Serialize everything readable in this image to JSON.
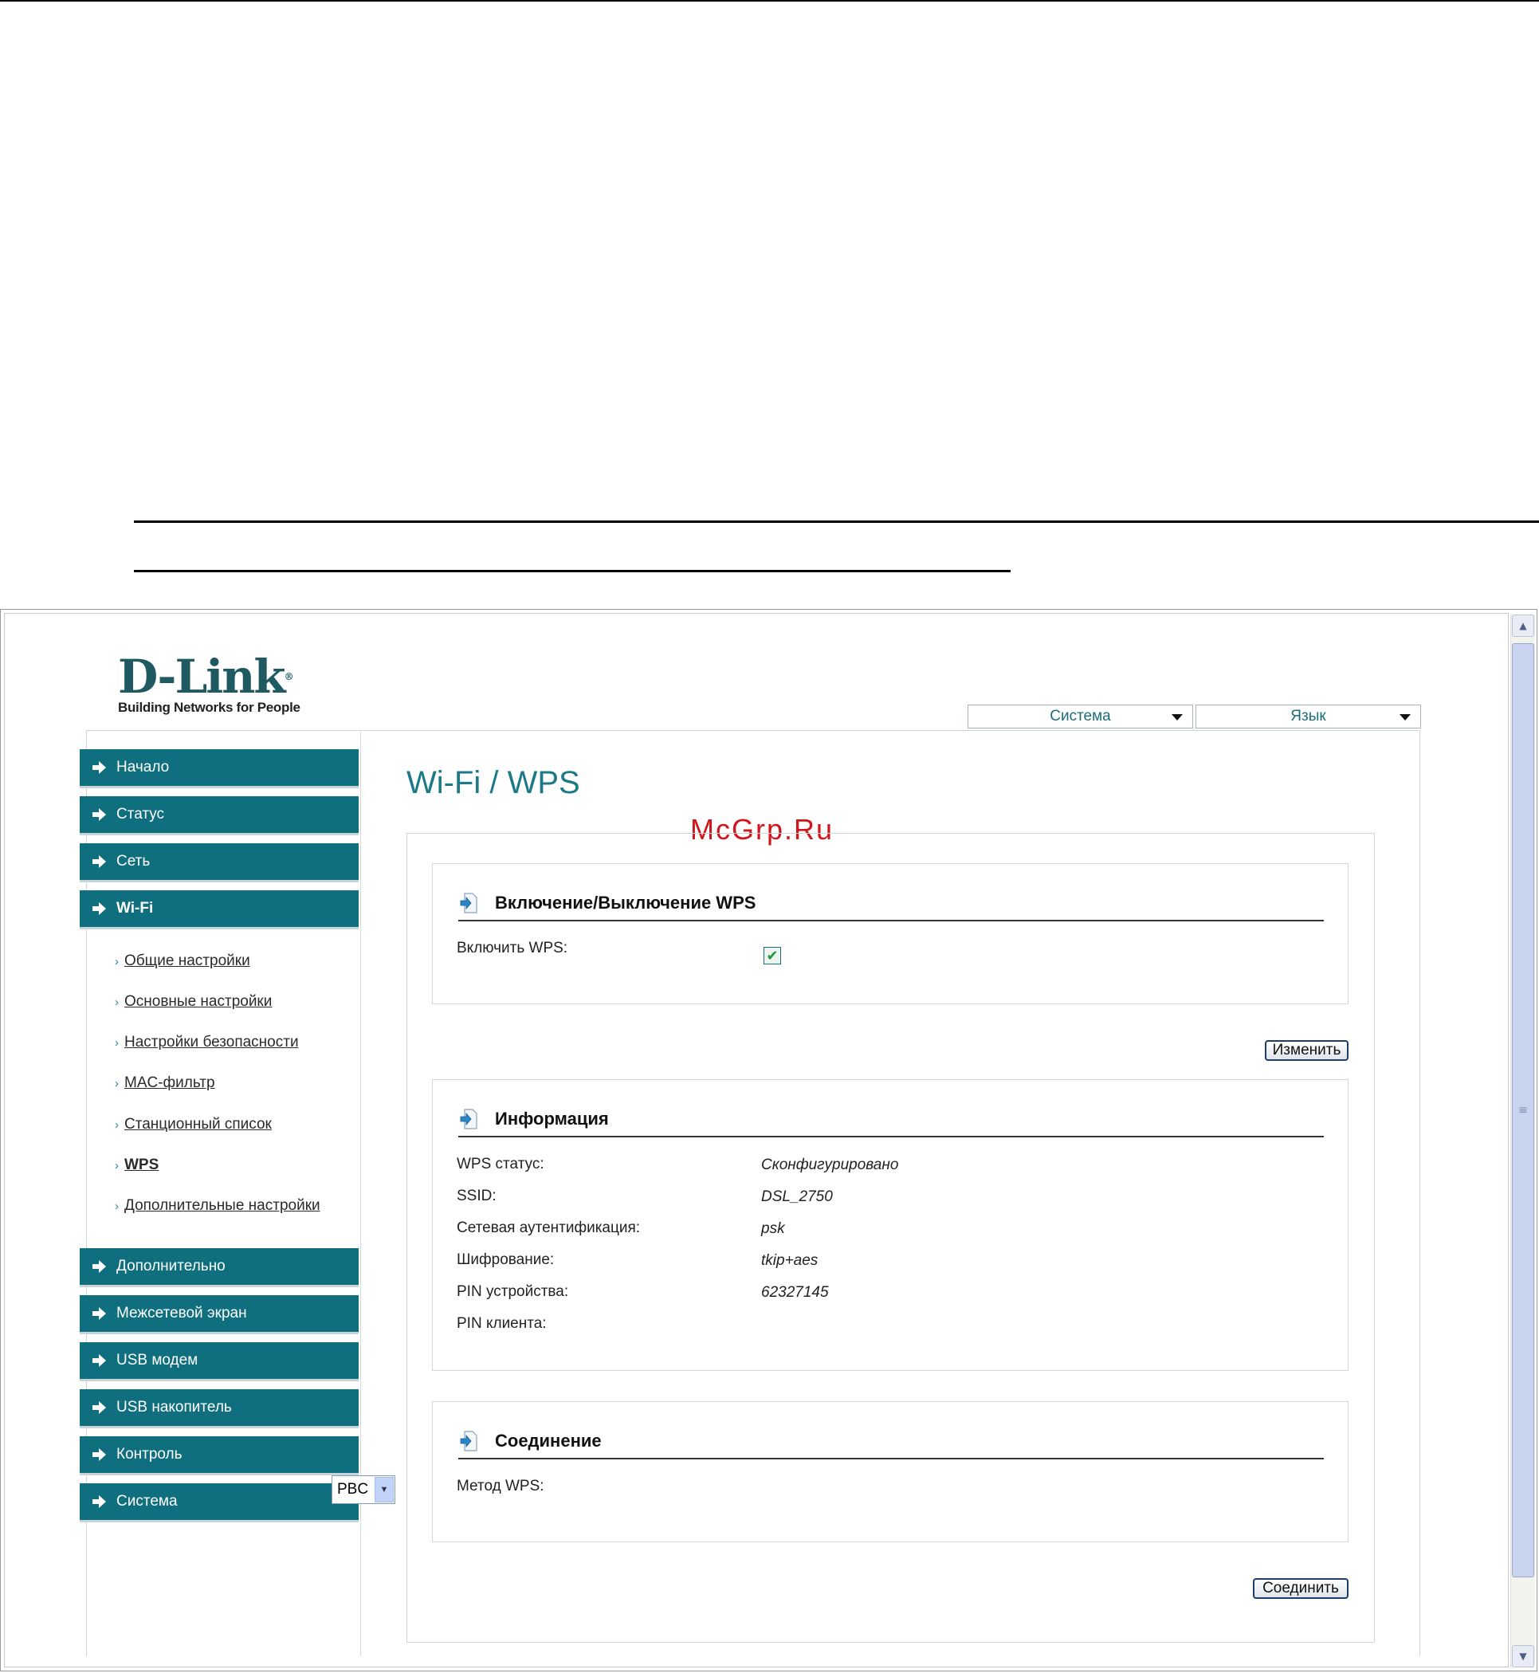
{
  "brand": {
    "logo_text": "D-Link",
    "tagline": "Building Networks for People"
  },
  "top_menu": {
    "system_label": "Система",
    "language_label": "Язык"
  },
  "sidebar": {
    "items": [
      {
        "label": "Начало"
      },
      {
        "label": "Статус"
      },
      {
        "label": "Сеть"
      },
      {
        "label": "Wi-Fi"
      },
      {
        "label": "Дополнительно"
      },
      {
        "label": "Межсетевой экран"
      },
      {
        "label": "USB модем"
      },
      {
        "label": "USB накопитель"
      },
      {
        "label": "Контроль"
      },
      {
        "label": "Система"
      }
    ],
    "wifi_subitems": [
      {
        "label": "Общие настройки"
      },
      {
        "label": "Основные настройки"
      },
      {
        "label": "Настройки безопасности"
      },
      {
        "label": "MAC-фильтр"
      },
      {
        "label": "Станционный список"
      },
      {
        "label": "WPS"
      },
      {
        "label": "Дополнительные настройки"
      }
    ],
    "active_subitem": "WPS"
  },
  "page": {
    "title": "Wi-Fi / WPS",
    "watermark": "McGrp.Ru"
  },
  "sections": {
    "wps_toggle": {
      "title": "Включение/Выключение WPS",
      "enable_label": "Включить WPS:",
      "enabled": true,
      "button": "Изменить"
    },
    "info": {
      "title": "Информация",
      "rows": [
        {
          "label": "WPS статус:",
          "value": "Сконфигурировано"
        },
        {
          "label": "SSID:",
          "value": "DSL_2750"
        },
        {
          "label": "Сетевая аутентификация:",
          "value": "psk"
        },
        {
          "label": "Шифрование:",
          "value": "tkip+aes"
        },
        {
          "label": "PIN устройства:",
          "value": "62327145"
        },
        {
          "label": "PIN клиента:",
          "value": ""
        }
      ]
    },
    "connection": {
      "title": "Соединение",
      "method_label": "Метод WPS:",
      "method_value": "PBC",
      "button": "Соединить"
    }
  },
  "icons": {
    "section_icon": "document-arrow-icon",
    "nav_icon": "arrow-right-icon",
    "checkbox_icon": "check-icon"
  },
  "colors": {
    "nav_bg": "#0f6f7f",
    "title": "#1c7a88",
    "watermark": "#d0161d"
  }
}
